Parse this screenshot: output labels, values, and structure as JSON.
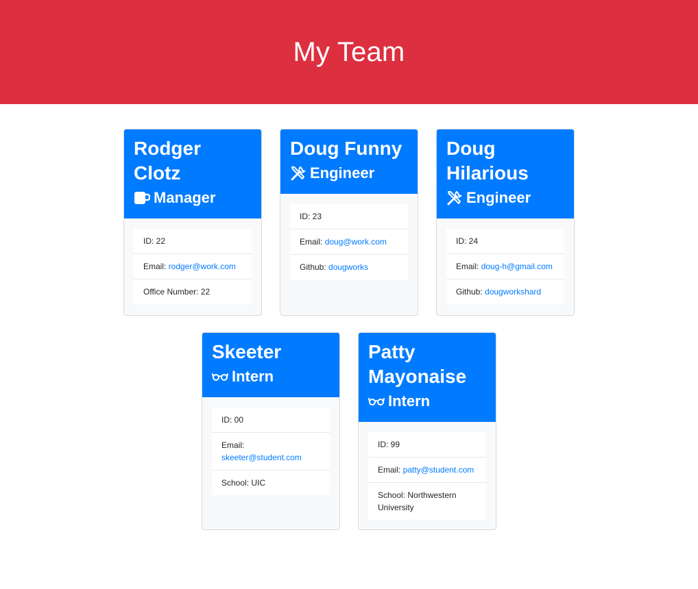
{
  "page_title": "My Team",
  "employees": [
    {
      "name": "Rodger Clotz",
      "role": "Manager",
      "icon": "mug-icon",
      "id_label": "ID: ",
      "id": "22",
      "email_label": "Email: ",
      "email": "rodger@work.com",
      "extra_label": "Office Number: ",
      "extra": "22"
    },
    {
      "name": "Doug Funny",
      "role": "Engineer",
      "icon": "tools-icon",
      "id_label": "ID: ",
      "id": "23",
      "email_label": "Email: ",
      "email": "doug@work.com",
      "extra_label": "Github: ",
      "extra": "dougworks"
    },
    {
      "name": "Doug Hilarious",
      "role": "Engineer",
      "icon": "tools-icon",
      "id_label": "ID: ",
      "id": "24",
      "email_label": "Email: ",
      "email": "doug-h@gmail.com",
      "extra_label": "Github: ",
      "extra": "dougworkshard"
    },
    {
      "name": "Skeeter",
      "role": "Intern",
      "icon": "glasses-icon",
      "id_label": "ID: ",
      "id": "00",
      "email_label": "Email: ",
      "email": "skeeter@student.com",
      "extra_label": "School: ",
      "extra": "UIC"
    },
    {
      "name": "Patty Mayonaise",
      "role": "Intern",
      "icon": "glasses-icon",
      "id_label": "ID: ",
      "id": "99",
      "email_label": "Email: ",
      "email": "patty@student.com",
      "extra_label": "School: ",
      "extra": "Northwestern University"
    }
  ],
  "colors": {
    "header_bg": "#dc3040",
    "card_header_bg": "#007bff",
    "link": "#007bff"
  }
}
